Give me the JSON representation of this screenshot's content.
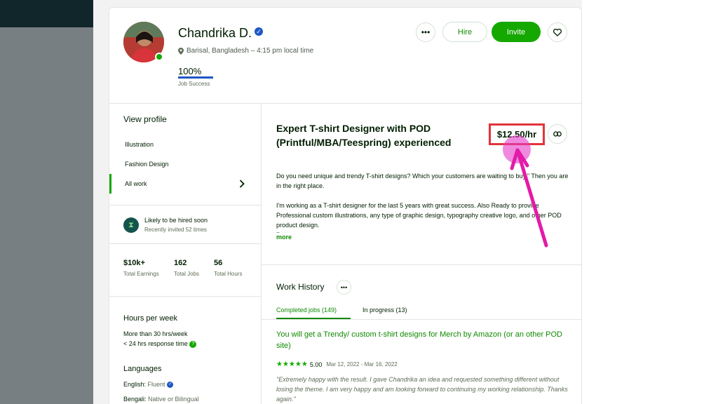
{
  "profile": {
    "name": "Chandrika D.",
    "location": "Barisal, Bangladesh – 4:15 pm local time",
    "job_success_value": "100%",
    "job_success_label": "Job Success"
  },
  "actions": {
    "more_label": "•••",
    "hire_label": "Hire",
    "invite_label": "Invite"
  },
  "sidebar": {
    "view_profile": "View profile",
    "items": [
      {
        "label": "Illustration"
      },
      {
        "label": "Fashion Design"
      },
      {
        "label": "All work"
      }
    ],
    "likely_title": "Likely to be hired soon",
    "likely_sub": "Recently invited 52 times",
    "stats": [
      {
        "value": "$10k+",
        "label": "Total Earnings"
      },
      {
        "value": "162",
        "label": "Total Jobs"
      },
      {
        "value": "56",
        "label": "Total Hours"
      }
    ],
    "hours_title": "Hours per week",
    "hours_line1": "More than 30 hrs/week",
    "hours_line2": "< 24 hrs response time",
    "languages_title": "Languages",
    "languages": [
      {
        "name": "English:",
        "level": "Fluent"
      },
      {
        "name": "Bengali:",
        "level": "Native or Bilingual"
      }
    ]
  },
  "main": {
    "headline": "Expert T-shirt Designer with POD (Printful/MBA/Teespring) experienced",
    "rate": "$12.50/hr",
    "desc_p1": "Do you need unique and trendy T-shirt designs? Which your customers are waiting to buy.\" Then you are in the right place.",
    "desc_p2": "I'm working as a T-shirt designer for the last 5 years with great success. Also Ready to provide Professional custom illustrations, any type of graphic design, typography creative logo, and other POD product design.",
    "desc_ellipsis": "..",
    "more_label": "more",
    "work_history_title": "Work History",
    "tabs": [
      {
        "label": "Completed jobs (149)"
      },
      {
        "label": "In progress (13)"
      }
    ],
    "job": {
      "title": "You will get a Trendy/ custom t-shirt designs for Merch by Amazon (or an other POD site)",
      "stars": "★★★★★",
      "rating": "5.00",
      "dates": "Mar 12, 2022 - Mar 16, 2022",
      "review": "\"Extremely happy with the result. I gave Chandrika an idea and requested something different without losing the theme. I am very happy and am looking forward to continuing my working relationship. Thanks again.\""
    }
  },
  "colors": {
    "brand_green": "#14a800",
    "link_green": "#108a00",
    "verified_blue": "#1f57c3",
    "highlight_red": "#e2333a",
    "annotation_pink": "#e41aa8"
  }
}
